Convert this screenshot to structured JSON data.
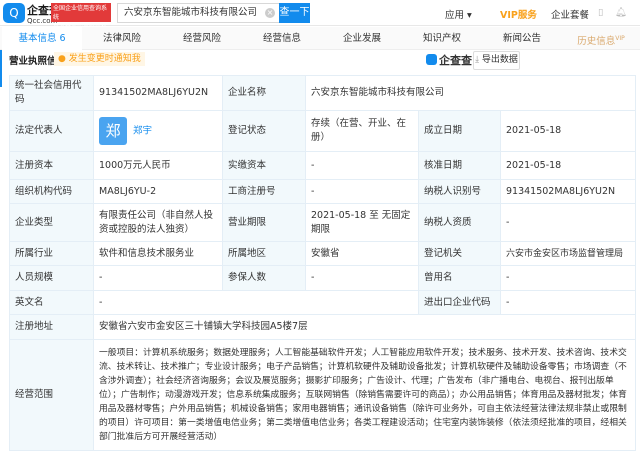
{
  "header": {
    "logo_icon": "qcc-logo-icon",
    "brand": "企查查",
    "brand_sub": "Qcc.com",
    "badge_line1": "全国企业信用查询系统",
    "badge_line2": "官方备案企业征信机构",
    "search_value": "六安京东智能城市科技有限公司",
    "search_button": "查一下",
    "nav": {
      "apps": "应用",
      "vip": "VIP服务",
      "suite": "企业套餐"
    }
  },
  "tabs": [
    {
      "label": "基本信息 6"
    },
    {
      "label": "法律风险"
    },
    {
      "label": "经营风险"
    },
    {
      "label": "经营信息"
    },
    {
      "label": "企业发展"
    },
    {
      "label": "知识产权"
    },
    {
      "label": "新闻公告"
    },
    {
      "label": "历史信息",
      "badge": "VIP"
    }
  ],
  "section": {
    "title": "营业执照信息",
    "notify": "发生变更时通知我",
    "brand": "企查查",
    "export": "导出数据"
  },
  "info": {
    "credit_code_label": "统一社会信用代码",
    "credit_code": "91341502MA8LJ6YU2N",
    "name_label": "企业名称",
    "name": "六安京东智能城市科技有限公司",
    "legal_label": "法定代表人",
    "legal_avatar": "郑",
    "legal": "郑宇",
    "status_label": "登记状态",
    "status": "存续（在营、开业、在册）",
    "founded_label": "成立日期",
    "founded": "2021-05-18",
    "capital_label": "注册资本",
    "capital": "1000万元人民币",
    "paid_label": "实缴资本",
    "paid": "-",
    "approved_label": "核准日期",
    "approved": "2021-05-18",
    "org_label": "组织机构代码",
    "org": "MA8LJ6YU-2",
    "reg_no_label": "工商注册号",
    "reg_no": "-",
    "tax_id_label": "纳税人识别号",
    "tax_id": "91341502MA8LJ6YU2N",
    "type_label": "企业类型",
    "type": "有限责任公司（非自然人投资或控股的法人独资）",
    "term_label": "营业期限",
    "term": "2021-05-18 至 无固定期限",
    "taxpayer_label": "纳税人资质",
    "taxpayer": "-",
    "industry_label": "所属行业",
    "industry": "软件和信息技术服务业",
    "region_label": "所属地区",
    "region": "安徽省",
    "authority_label": "登记机关",
    "authority": "六安市金安区市场监督管理局",
    "staff_label": "人员规模",
    "staff": "-",
    "insured_label": "参保人数",
    "insured": "-",
    "former_label": "曾用名",
    "former": "-",
    "en_label": "英文名",
    "en": "-",
    "ie_label": "进出口企业代码",
    "ie": "-",
    "address_label": "注册地址",
    "address": "安徽省六安市金安区三十铺镇大学科技园A5楼7层",
    "scope_label": "经营范围",
    "scope": "一般项目：计算机系统服务；数据处理服务；人工智能基础软件开发；人工智能应用软件开发；技术服务、技术开发、技术咨询、技术交流、技术转让、技术推广；专业设计服务；电子产品销售；计算机软硬件及辅助设备批发；计算机软硬件及辅助设备零售；市场调查（不含涉外调查）；社会经济咨询服务；会议及展览服务；摄影扩印服务；广告设计、代理；广告发布（非广播电台、电视台、报刊出版单位）；广告制作；动漫游戏开发；信息系统集成服务；互联网销售（除销售需要许可的商品）；办公用品销售；体育用品及器材批发；体育用品及器材零售；户外用品销售；机械设备销售；家用电器销售；通讯设备销售（除许可业务外，可自主依法经营法律法规非禁止或限制的项目）许可项目：第一类增值电信业务；第二类增值电信业务；各类工程建设活动；住宅室内装饰装修（依法须经批准的项目，经相关部门批准后方可开展经营活动）"
  }
}
